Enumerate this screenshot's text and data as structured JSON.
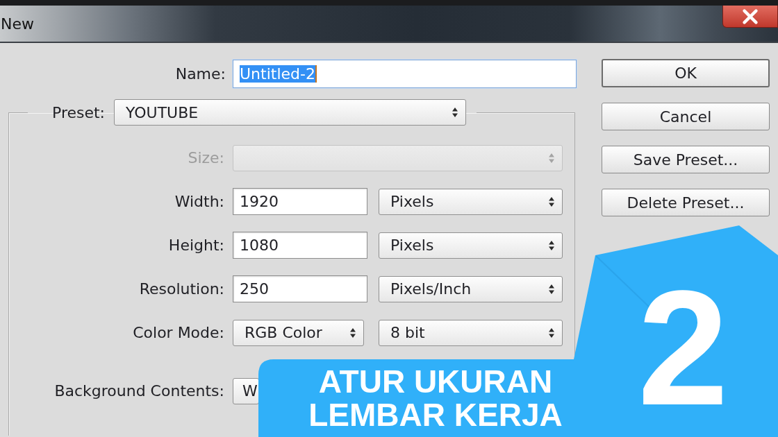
{
  "window": {
    "title": "New"
  },
  "name_field": {
    "label": "Name:",
    "value": "Untitled-2",
    "focused": true,
    "text_selected": true
  },
  "preset": {
    "label": "Preset:",
    "value": "YOUTUBE"
  },
  "rows": [
    {
      "label": "Size:",
      "disabled": true,
      "controls": [
        {
          "kind": "select"
        }
      ]
    },
    {
      "label": "Width:",
      "disabled": false,
      "controls": [
        {
          "kind": "input",
          "value": "1920"
        },
        {
          "kind": "select",
          "value": "Pixels"
        }
      ]
    },
    {
      "label": "Height:",
      "disabled": false,
      "controls": [
        {
          "kind": "input",
          "value": "1080"
        },
        {
          "kind": "select",
          "value": "Pixels"
        }
      ]
    },
    {
      "label": "Resolution:",
      "disabled": false,
      "controls": [
        {
          "kind": "input",
          "value": "250"
        },
        {
          "kind": "select",
          "value": "Pixels/Inch"
        }
      ]
    },
    {
      "label": "Color Mode:",
      "disabled": false,
      "controls": [
        {
          "kind": "select",
          "value": "RGB Color"
        },
        {
          "kind": "select",
          "value": "8 bit"
        }
      ]
    }
  ],
  "background_contents": {
    "label": "Background Contents:",
    "value": "W"
  },
  "buttons": [
    {
      "label": "OK",
      "default": true
    },
    {
      "label": "Cancel",
      "default": false
    },
    {
      "label": "Save Preset...",
      "default": false
    },
    {
      "label": "Delete Preset...",
      "default": false
    }
  ],
  "step_banner": {
    "title": "ATUR UKURAN LEMBAR KERJA",
    "step": "2"
  }
}
